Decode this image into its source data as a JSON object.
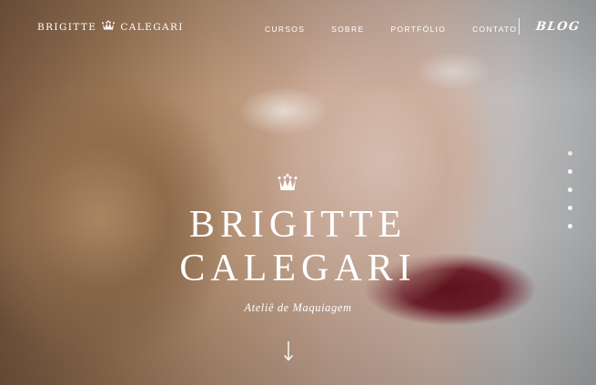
{
  "header": {
    "logo": {
      "left_text": "BRIGITTE",
      "right_text": "CALEGARI",
      "icon": "crown-icon"
    },
    "nav": [
      {
        "label": "CURSOS"
      },
      {
        "label": "SOBRE"
      },
      {
        "label": "PORTFÓLIO"
      },
      {
        "label": "CONTATO"
      }
    ],
    "blog_label": "BLOG"
  },
  "hero": {
    "icon": "crown-icon",
    "title_line1": "BRIGITTE",
    "title_line2": "CALEGARI",
    "subtitle": "Ateliê de Maquiagem",
    "scroll_icon": "arrow-down-icon",
    "slides": {
      "count": 5,
      "active_index": 0
    }
  },
  "colors": {
    "text": "#ffffff",
    "lip": "#7a2230"
  }
}
